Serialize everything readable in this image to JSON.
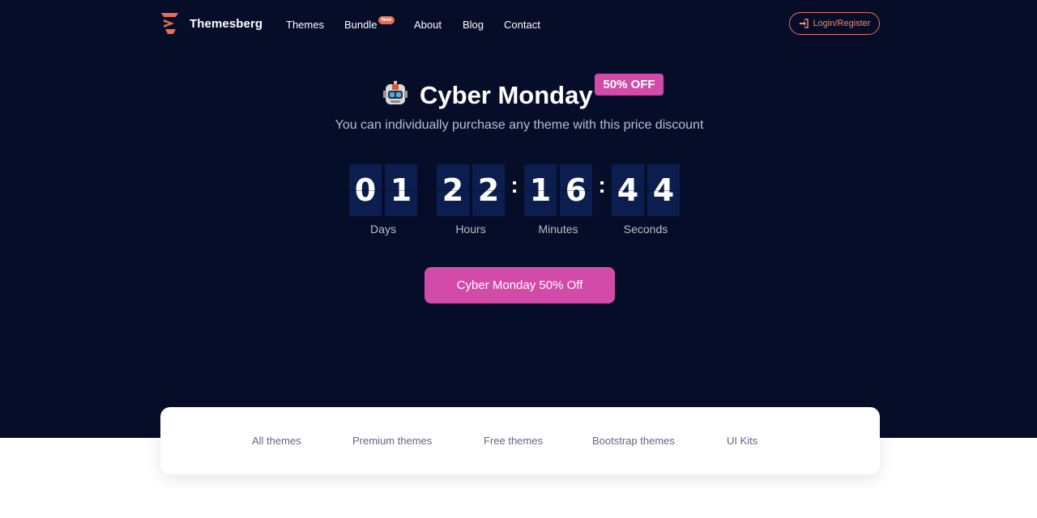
{
  "nav": {
    "brand": "Themesberg",
    "links": [
      "Themes",
      "Bundle",
      "About",
      "Blog",
      "Contact"
    ],
    "badge_new": "New",
    "login_label": "Login/Register"
  },
  "hero": {
    "title": "Cyber Monday",
    "off_badge": "50% OFF",
    "subtitle": "You can individually purchase any theme with this price discount",
    "countdown": {
      "days": [
        "0",
        "1"
      ],
      "hours": [
        "2",
        "2"
      ],
      "minutes": [
        "1",
        "6"
      ],
      "seconds": [
        "4",
        "4"
      ],
      "separator": ":",
      "labels": [
        "Days",
        "Hours",
        "Minutes",
        "Seconds"
      ]
    },
    "cta_label": "Cyber Monday 50% Off"
  },
  "tabs": [
    "All themes",
    "Premium themes",
    "Free themes",
    "Bootstrap themes",
    "UI Kits"
  ],
  "colors": {
    "hero_bg": "#050d28",
    "accent_pink": "#d34ba8",
    "accent_orange": "#e76f51",
    "digit_bg": "#0b1e4f"
  },
  "icons": [
    "themesberg-logo-icon",
    "robot-icon",
    "sign-in-icon"
  ]
}
